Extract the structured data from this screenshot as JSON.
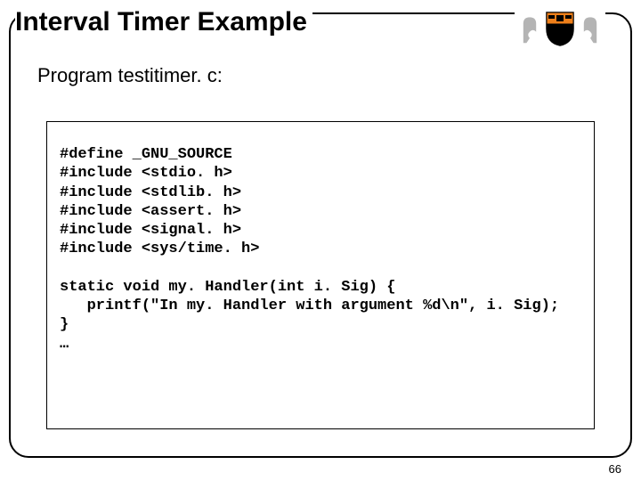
{
  "header": {
    "title": "Interval Timer Example"
  },
  "subtitle": "Program testitimer. c:",
  "code": {
    "lines": [
      "#define _GNU_SOURCE",
      "#include <stdio. h>",
      "#include <stdlib. h>",
      "#include <assert. h>",
      "#include <signal. h>",
      "#include <sys/time. h>",
      "",
      "static void my. Handler(int i. Sig) {",
      "   printf(\"In my. Handler with argument %d\\n\", i. Sig);",
      "}",
      "…"
    ]
  },
  "page_number": "66",
  "logo": {
    "name": "princeton-shield"
  }
}
